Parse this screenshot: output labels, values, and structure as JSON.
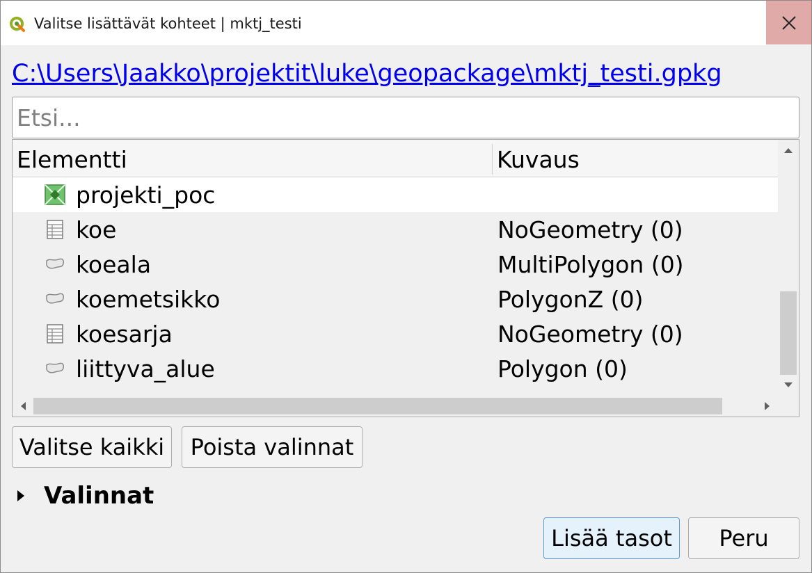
{
  "window": {
    "title": "Valitse lisättävät kohteet | mktj_testi",
    "app_icon": "qgis-icon",
    "close_icon": "close-icon"
  },
  "source_path": "C:\\Users\\Jaakko\\projektit\\luke\\geopackage\\mktj_testi.gpkg",
  "search": {
    "placeholder": "Etsi...",
    "value": ""
  },
  "table": {
    "columns": [
      "Elementti",
      "Kuvaus"
    ],
    "rows": [
      {
        "name": "projekti_poc",
        "description": "",
        "icon": "raster-layer-icon",
        "selected": true
      },
      {
        "name": "koe",
        "description": "NoGeometry (0)",
        "icon": "table-icon"
      },
      {
        "name": "koeala",
        "description": "MultiPolygon (0)",
        "icon": "polygon-layer-icon"
      },
      {
        "name": "koemetsikko",
        "description": "PolygonZ (0)",
        "icon": "polygon-layer-icon"
      },
      {
        "name": "koesarja",
        "description": "NoGeometry (0)",
        "icon": "table-icon"
      },
      {
        "name": "liittyva_alue",
        "description": "Polygon (0)",
        "icon": "polygon-layer-icon"
      }
    ]
  },
  "buttons": {
    "select_all": "Valitse kaikki",
    "clear_selection": "Poista valinnat",
    "add_layers": "Lisää tasot",
    "cancel": "Peru"
  },
  "options_section": {
    "label": "Valinnat",
    "expanded": false
  }
}
